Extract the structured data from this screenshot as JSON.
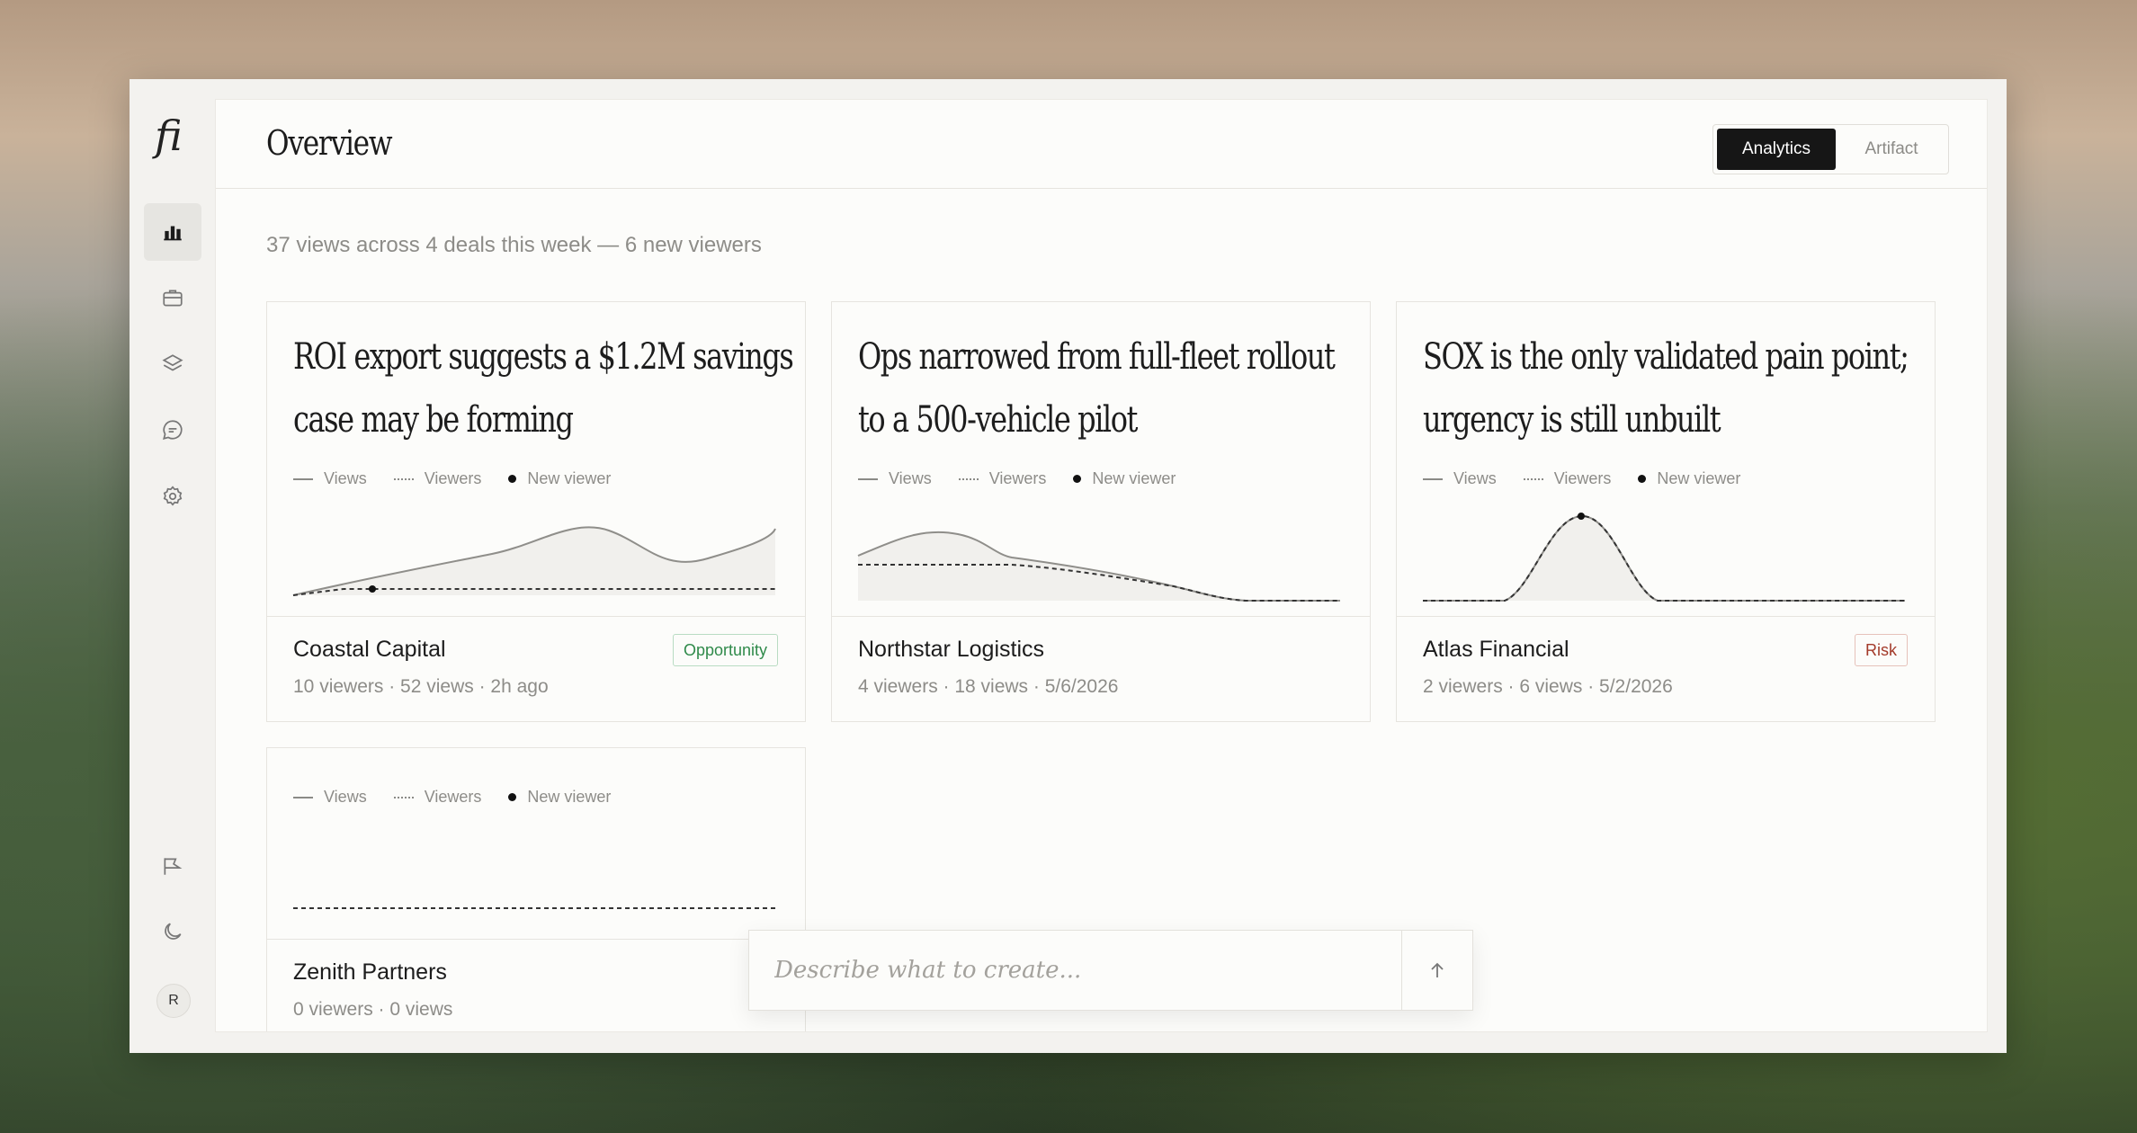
{
  "app": {
    "logo_text": "fi",
    "page_title": "Overview",
    "view_toggle": {
      "active": "Analytics",
      "inactive": "Artifact"
    },
    "summary": "37 views across 4 deals this week — 6 new viewers"
  },
  "sidebar": {
    "nav_icons": [
      "bar-chart-icon",
      "briefcase-icon",
      "layers-icon",
      "chat-icon",
      "settings-icon"
    ],
    "bottom_icons": [
      "announce-icon",
      "moon-icon"
    ],
    "avatar_initial": "R"
  },
  "legend": {
    "views": "Views",
    "viewers": "Viewers",
    "new_viewer": "New viewer"
  },
  "cards": [
    {
      "headline": "ROI export suggests a $1.2M savings case may be forming",
      "deal": "Coastal Capital",
      "meta": "10 viewers · 52 views · 2h ago",
      "badge": "Opportunity"
    },
    {
      "headline": "Ops narrowed from full-fleet rollout to a 500-vehicle pilot",
      "deal": "Northstar Logistics",
      "meta": "4 viewers · 18 views · 5/6/2026",
      "badge": ""
    },
    {
      "headline": "SOX is the only validated pain point; urgency is still unbuilt",
      "deal": "Atlas Financial",
      "meta": "2 viewers · 6 views · 5/2/2026",
      "badge": "Risk"
    },
    {
      "headline": "",
      "deal": "Zenith Partners",
      "meta": "0 viewers · 0 views",
      "badge": ""
    }
  ],
  "prompt": {
    "placeholder": "Describe what to create..."
  },
  "colors": {
    "opportunity": "#2f8a4a",
    "risk": "#a33a2a",
    "accent": "#161616"
  }
}
